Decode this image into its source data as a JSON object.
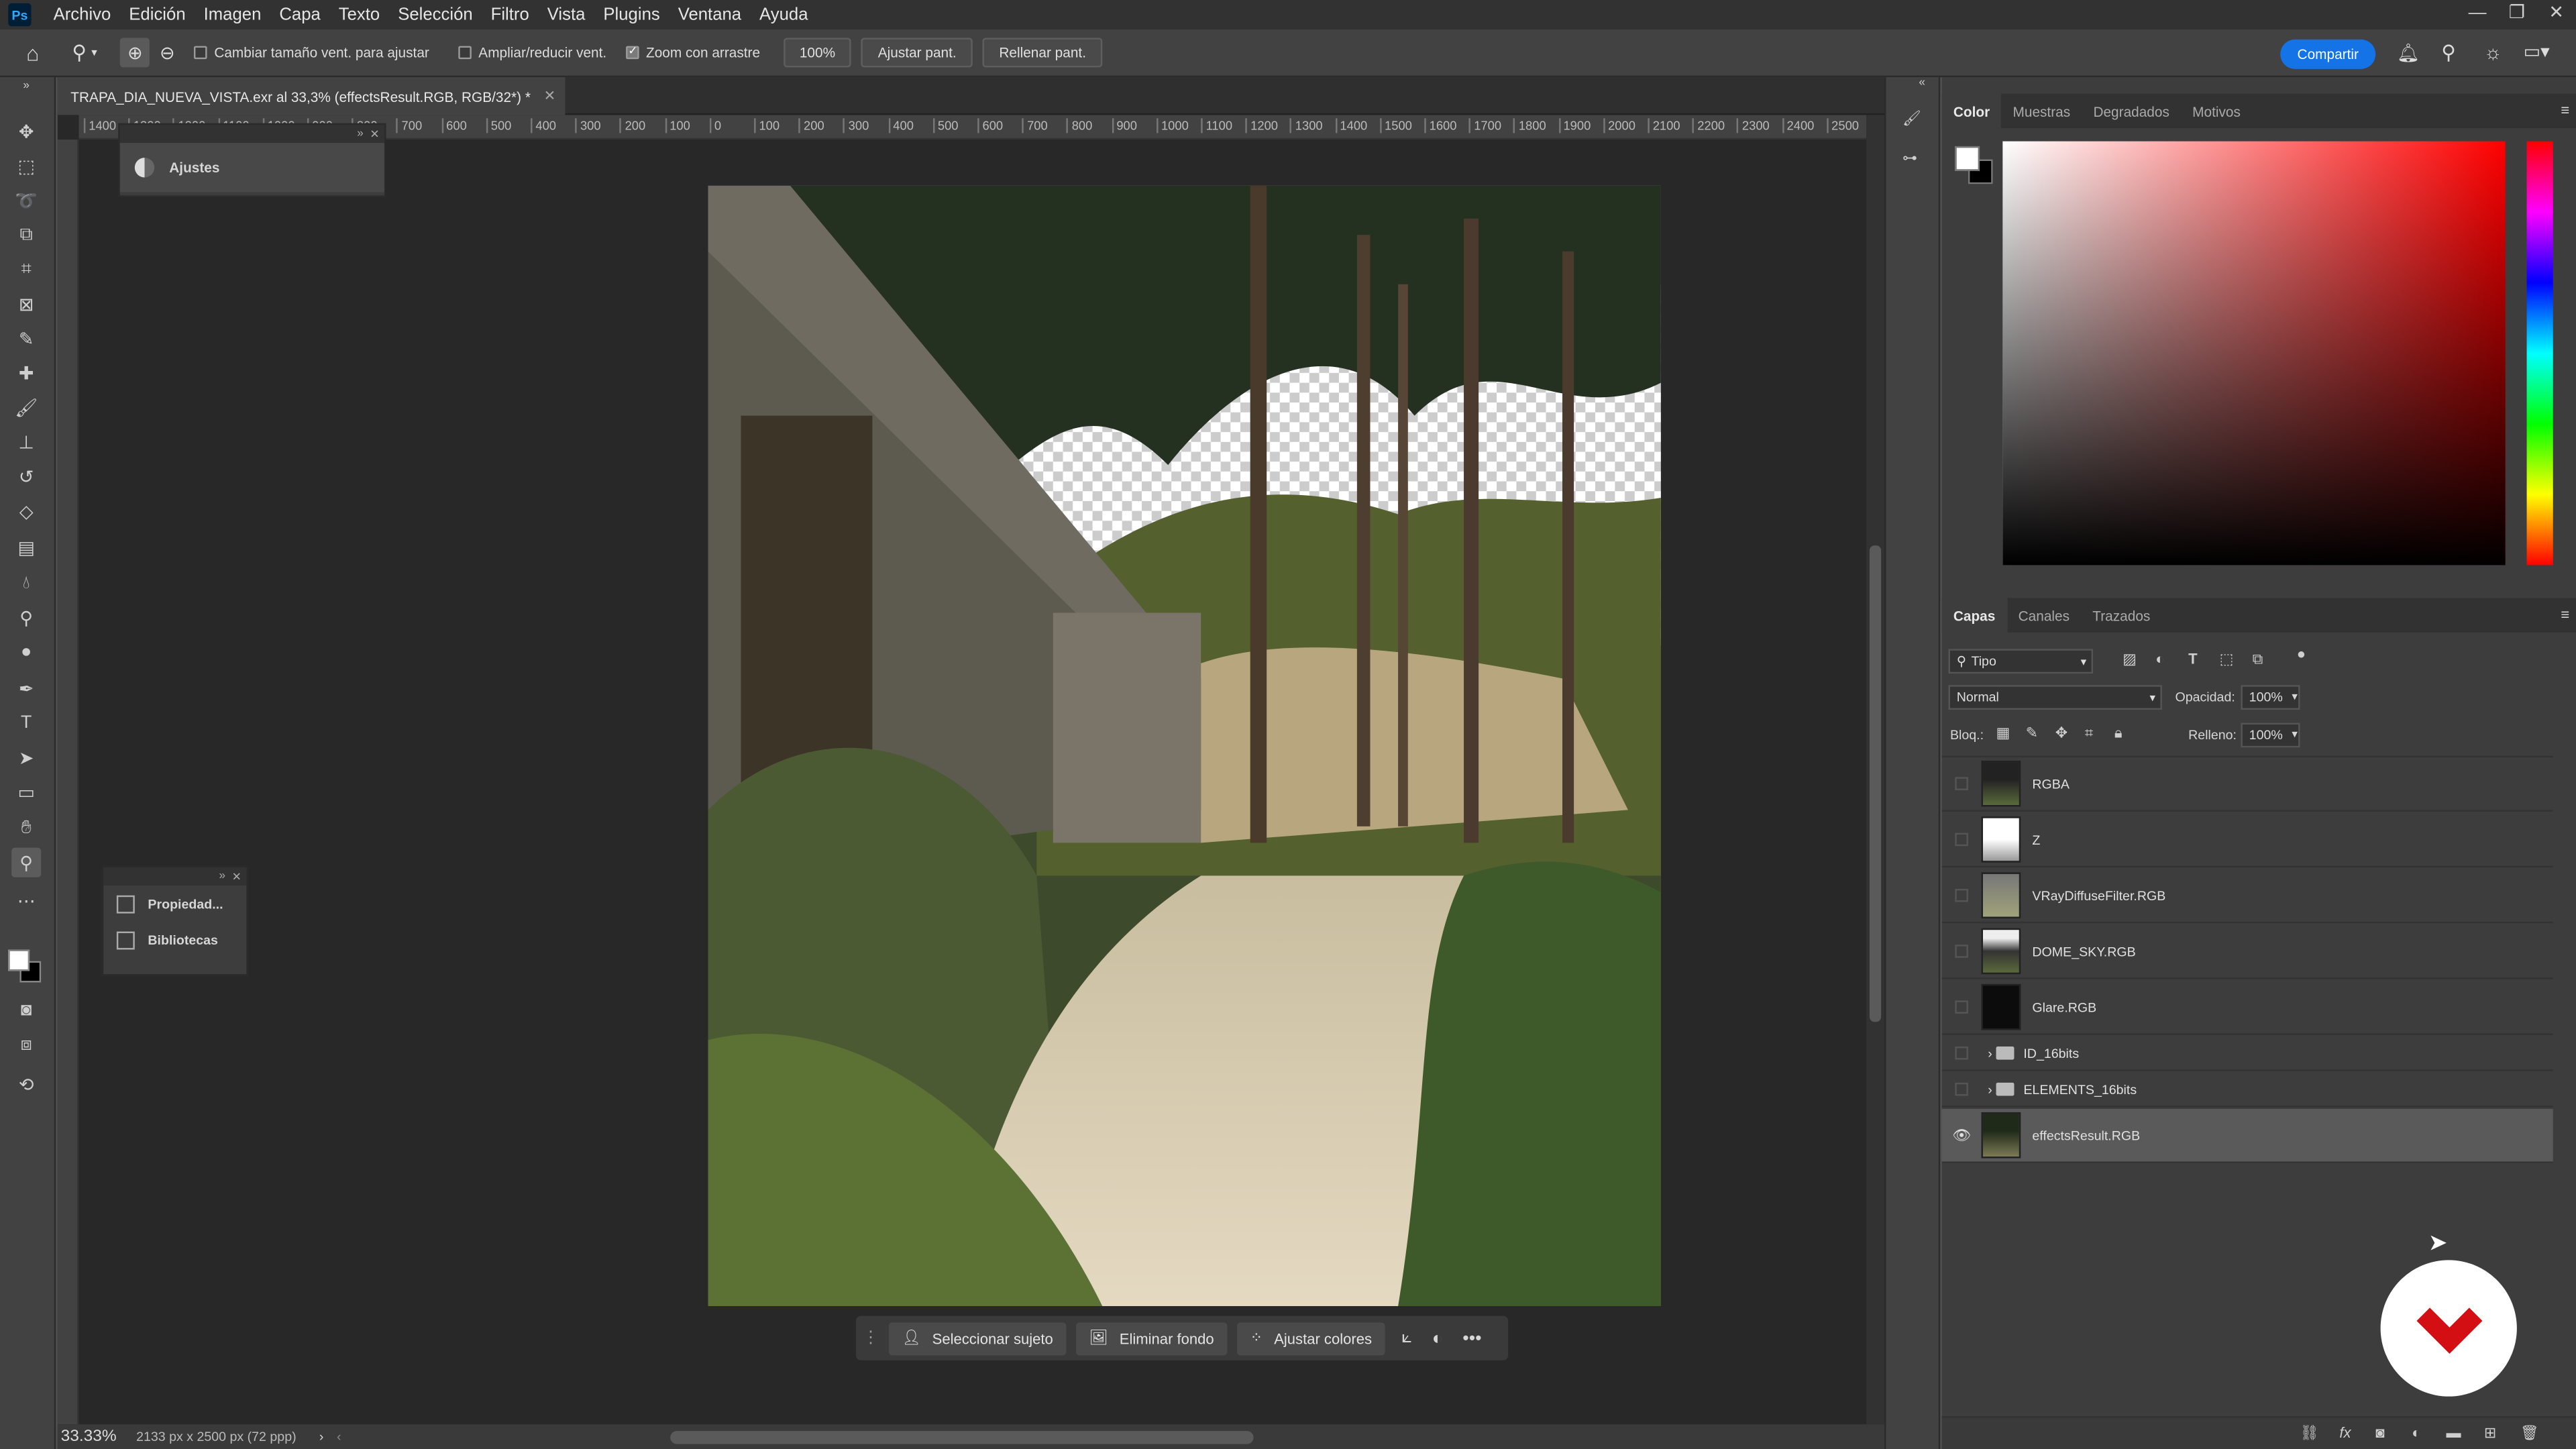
{
  "app": {
    "logo": "Ps"
  },
  "menu": [
    "Archivo",
    "Edición",
    "Imagen",
    "Capa",
    "Texto",
    "Selección",
    "Filtro",
    "Vista",
    "Plugins",
    "Ventana",
    "Ayuda"
  ],
  "window_controls": {
    "minimize": "—",
    "restore": "❐",
    "close": "✕"
  },
  "options_bar": {
    "resize_windows_label": "Cambiar tamaño vent. para ajustar",
    "resize_windows_checked": false,
    "zoom_all_label": "Ampliar/reducir vent.",
    "zoom_all_checked": false,
    "scrubby_zoom_label": "Zoom con arrastre",
    "scrubby_zoom_checked": true,
    "zoom_100": "100%",
    "fit_screen": "Ajustar pant.",
    "fill_screen": "Rellenar pant.",
    "share": "Compartir"
  },
  "document": {
    "tab_title": "TRAPA_DIA_NUEVA_VISTA.exr al 33,3% (effectsResult.RGB, RGB/32*) *",
    "zoom": "33.33%",
    "dimensions": "2133 px x 2500 px (72 ppp)"
  },
  "ruler": {
    "labels": [
      "1400",
      "1300",
      "1200",
      "1100",
      "1000",
      "900",
      "800",
      "700",
      "600",
      "500",
      "400",
      "300",
      "200",
      "100",
      "0",
      "100",
      "200",
      "300",
      "400",
      "500",
      "600",
      "700",
      "800",
      "900",
      "1000",
      "1100",
      "1200",
      "1300",
      "1400",
      "1500",
      "1600",
      "1700",
      "1800",
      "1900",
      "2000",
      "2100",
      "2200",
      "2300",
      "2400",
      "2500"
    ]
  },
  "floating_panels": {
    "adjustments": "Ajustes",
    "properties": "Propiedad...",
    "libraries": "Bibliotecas"
  },
  "contextual_taskbar": {
    "select_subject": "Seleccionar sujeto",
    "remove_bg": "Eliminar fondo",
    "adjust_colors": "Ajustar colores"
  },
  "color_panel": {
    "tabs": [
      "Color",
      "Muestras",
      "Degradados",
      "Motivos"
    ],
    "active_tab": "Color",
    "foreground": "#ffffff",
    "background": "#000000",
    "hue_color": "#ff0000"
  },
  "layers_panel": {
    "tabs": [
      "Capas",
      "Canales",
      "Trazados"
    ],
    "active_tab": "Capas",
    "filter_kind": "Tipo",
    "blend_mode": "Normal",
    "opacity_label": "Opacidad:",
    "opacity": "100%",
    "lock_label": "Bloq.:",
    "fill_label": "Relleno:",
    "fill": "100%",
    "layers": [
      {
        "name": "RGBA",
        "type": "layer",
        "visible": false,
        "selected": false
      },
      {
        "name": "Z",
        "type": "layer",
        "visible": false,
        "selected": false
      },
      {
        "name": "VRayDiffuseFilter.RGB",
        "type": "layer",
        "visible": false,
        "selected": false
      },
      {
        "name": "DOME_SKY.RGB",
        "type": "layer",
        "visible": false,
        "selected": false
      },
      {
        "name": "Glare.RGB",
        "type": "layer",
        "visible": false,
        "selected": false
      },
      {
        "name": "ID_16bits",
        "type": "group",
        "visible": false,
        "selected": false
      },
      {
        "name": "ELEMENTS_16bits",
        "type": "group",
        "visible": false,
        "selected": false
      },
      {
        "name": "effectsResult.RGB",
        "type": "layer",
        "visible": true,
        "selected": true
      }
    ]
  },
  "accent": "#1473e6"
}
